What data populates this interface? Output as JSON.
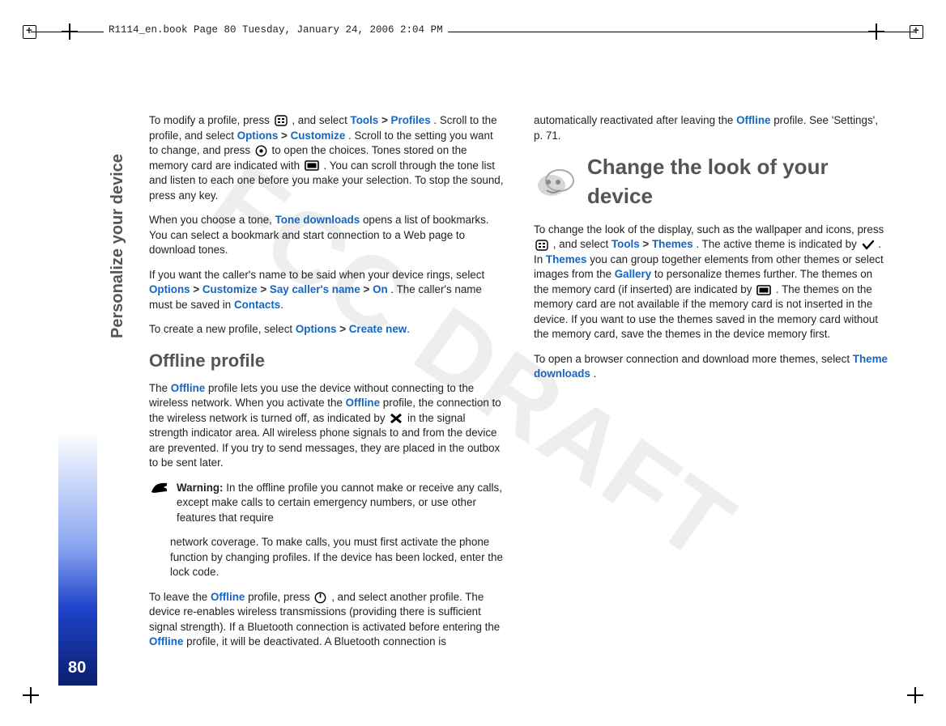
{
  "header": {
    "crop_text": "R1114_en.book  Page 80  Tuesday, January 24, 2006  2:04 PM"
  },
  "side_label": "Personalize your device",
  "page_number": "80",
  "watermark": "FCC DRAFT",
  "sep": ">",
  "body": {
    "p1a": "To modify a profile, press ",
    "p1b": ", and select ",
    "p1_tools": "Tools",
    "p1_profiles": "Profiles",
    "p1c": ". Scroll to the profile, and select ",
    "p1_options": "Options",
    "p1_customize": "Customize",
    "p1d": ". Scroll to the setting you want to change, and press ",
    "p1e": " to open the choices. Tones stored on the memory card are indicated with ",
    "p1f": ". You can scroll through the tone list and listen to each one before you make your selection. To stop the sound, press any key.",
    "p2a": "When you choose a tone, ",
    "p2_tonedl": "Tone downloads",
    "p2b": " opens a list of bookmarks. You can select a bookmark and start connection to a Web page to download tones.",
    "p3a": "If you want the caller's name to be said when your device rings, select ",
    "p3_options": "Options",
    "p3_customize": "Customize",
    "p3_say": "Say caller's name",
    "p3_on": "On",
    "p3b": ". The caller's name must be saved in ",
    "p3_contacts": "Contacts",
    "p4a": "To create a new profile, select ",
    "p4_options": "Options",
    "p4_createnew": "Create new",
    "h_offline": "Offline profile",
    "p5a": "The ",
    "p5_offline1": "Offline",
    "p5b": " profile lets you use the device without connecting to the wireless network. When you activate the ",
    "p5_offline2": "Offline",
    "p5c": " profile, the connection to the wireless network is turned off, as indicated by ",
    "p5d": " in the signal strength indicator area. All wireless phone signals to and from the device are prevented. If you try to send messages, they are placed in the outbox to be sent later.",
    "warn_label": "Warning:",
    "warn_text": " In the offline profile you cannot make or receive any calls, except make calls to certain emergency numbers, or use other features that require",
    "warn_cont": "network coverage. To make calls, you must first activate the phone function by changing profiles. If the device has been locked, enter the lock code.",
    "p6a": "To leave the ",
    "p6_offline1": "Offline",
    "p6b": " profile, press ",
    "p6c": ", and select another profile. The device re-enables wireless transmissions (providing there is sufficient signal strength). If a Bluetooth connection is activated before entering the ",
    "p6_offline2": "Offline",
    "p6d": " profile, it will be deactivated. A Bluetooth connection is automatically reactivated after leaving the ",
    "p6_offline3": "Offline",
    "p6e": " profile. See 'Settings', p. 71.",
    "h_look": "Change the look of your device",
    "p7a": "To change the look of the display, such as the wallpaper and icons, press ",
    "p7b": ", and select ",
    "p7_tools": "Tools",
    "p7_themes": "Themes",
    "p7c": ". The active theme is indicated by ",
    "p7d": ". In ",
    "p7_themes2": "Themes",
    "p7e": " you can group together elements from other themes or select images from the ",
    "p7_gallery": "Gallery",
    "p7f": " to personalize themes further. The themes on the memory card (if inserted) are indicated by ",
    "p7g": ". The themes on the memory card are not available if the memory card is not inserted in the device. If you want to use the themes saved in the memory card without the memory card, save the themes in the device memory first.",
    "p8a": "To open a browser connection and download more themes, select ",
    "p8_themedl": "Theme downloads",
    "p8b": "."
  }
}
